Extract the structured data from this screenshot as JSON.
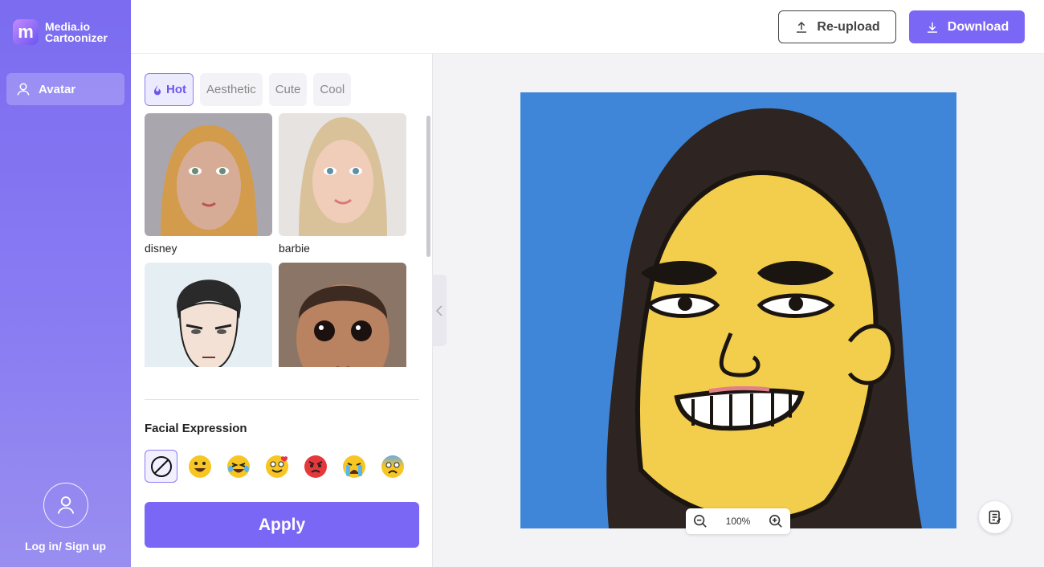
{
  "app": {
    "name_line1": "Media.io",
    "name_line2": "Cartoonizer",
    "logo_letter": "m"
  },
  "sidebar": {
    "items": [
      {
        "label": "Avatar",
        "icon": "user-icon",
        "active": true
      }
    ],
    "login_label": "Log in/ Sign up"
  },
  "toolbar": {
    "reupload_label": "Re-upload",
    "download_label": "Download"
  },
  "tabs": [
    {
      "label": "Hot",
      "active": true,
      "icon": "flame-icon"
    },
    {
      "label": "Aesthetic",
      "active": false
    },
    {
      "label": "Cute",
      "active": false
    },
    {
      "label": "Cool",
      "active": false
    }
  ],
  "styles": [
    {
      "label": "disney"
    },
    {
      "label": "barbie"
    },
    {
      "label": ""
    },
    {
      "label": ""
    }
  ],
  "facial_expression": {
    "title": "Facial Expression",
    "options": [
      "none-icon",
      "grin-emoji",
      "laughing-crying-emoji",
      "love-emoji",
      "angry-emoji",
      "crying-emoji",
      "shocked-emoji"
    ],
    "selected": "none-icon"
  },
  "apply_label": "Apply",
  "zoom": {
    "level": "100%"
  },
  "colors": {
    "accent": "#7b67f5",
    "preview_bg": "#3f86d8"
  }
}
